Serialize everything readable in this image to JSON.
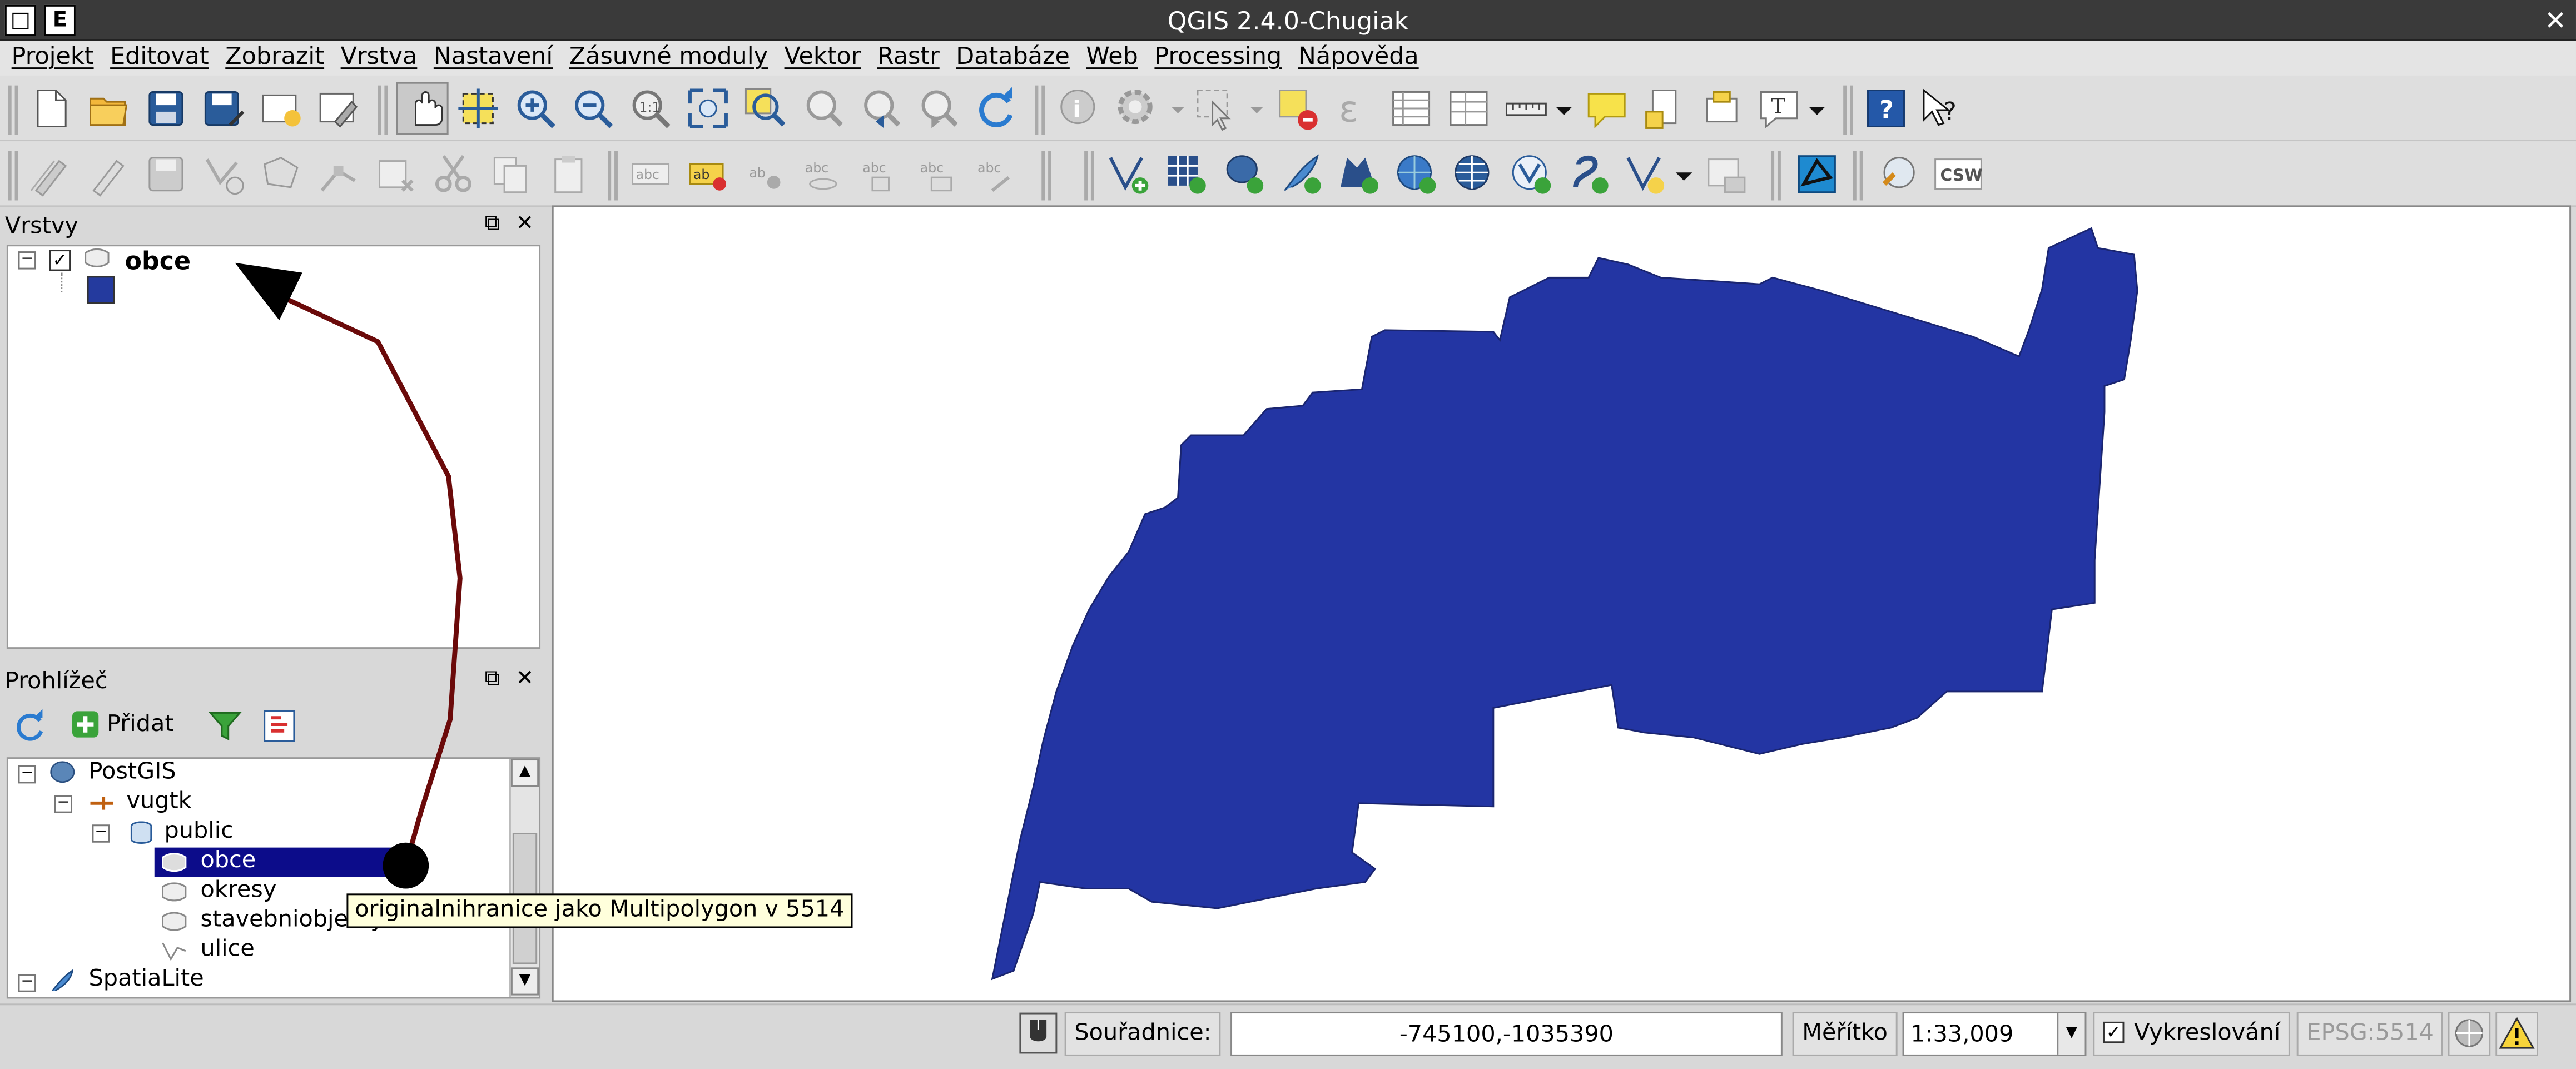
{
  "titlebar": {
    "title": "QGIS 2.4.0-Chugiak",
    "left_buttons": [
      "□",
      "E"
    ],
    "close_glyph": "✕"
  },
  "menu": [
    "Projekt",
    "Editovat",
    "Zobrazit",
    "Vrstva",
    "Nastavení",
    "Zásuvné moduly",
    "Vektor",
    "Rastr",
    "Databáze",
    "Web",
    "Processing",
    "Nápověda"
  ],
  "layers_panel": {
    "title": "Vrstvy",
    "layer_name": "obce",
    "layer_checked": true,
    "symbol_color": "#243a9e"
  },
  "browser_panel": {
    "title": "Prohlížeč",
    "add_label": "Přidat",
    "tree": {
      "postgis": "PostGIS",
      "connection": "vugtk",
      "schema": "public",
      "tables": [
        "obce",
        "okresy",
        "stavebniobjekty",
        "ulice"
      ],
      "selected": "obce",
      "spatialite": "SpatiaLite"
    },
    "tooltip": "originalnihranice jako Multipolygon v 5514"
  },
  "map": {
    "fill_color": "#2335a3",
    "stroke_color": "#1a2570",
    "arrow_color": "#6b0a0a"
  },
  "statusbar": {
    "coord_label": "Souřadnice:",
    "coord_value": "-745100,-1035390",
    "scale_label": "Měřítko",
    "scale_value": "1:33,009",
    "render_label": "Vykreslování",
    "render_checked": true,
    "crs": "EPSG:5514"
  },
  "icons": {
    "toolbar1": [
      "new-project",
      "open-project",
      "save-project",
      "save-as",
      "new-print-composer",
      "composer-manager",
      "pan",
      "pan-to-selection",
      "zoom-in",
      "zoom-out",
      "zoom-native",
      "zoom-full",
      "zoom-to-selection",
      "zoom-to-layer",
      "zoom-last",
      "zoom-next",
      "refresh",
      "identify",
      "run-action",
      "select-features",
      "deselect",
      "field-calculator",
      "attribute-table",
      "statistics",
      "measure",
      "map-tips",
      "new-bookmark",
      "show-bookmarks",
      "text-annotation",
      "help",
      "whats-this"
    ],
    "toolbar2": [
      "current-edits",
      "toggle-editing",
      "save-edits",
      "add-feature",
      "move-feature",
      "node-tool",
      "delete-selected",
      "cut-features",
      "copy-features",
      "paste-features",
      "label-tool",
      "pin-labels",
      "highlight-pinned",
      "move-label",
      "rotate-label",
      "change-label",
      "show-hide-labels",
      "add-vector-layer",
      "add-raster-layer",
      "add-postgis-layer",
      "add-spatialite-layer",
      "add-mssql-layer",
      "add-wms-layer",
      "add-wcs-layer",
      "add-wfs-layer",
      "add-delimited-text",
      "new-shapefile",
      "new-spatialite",
      "digitize",
      "georeferencer",
      "metasearch",
      "csw"
    ]
  }
}
